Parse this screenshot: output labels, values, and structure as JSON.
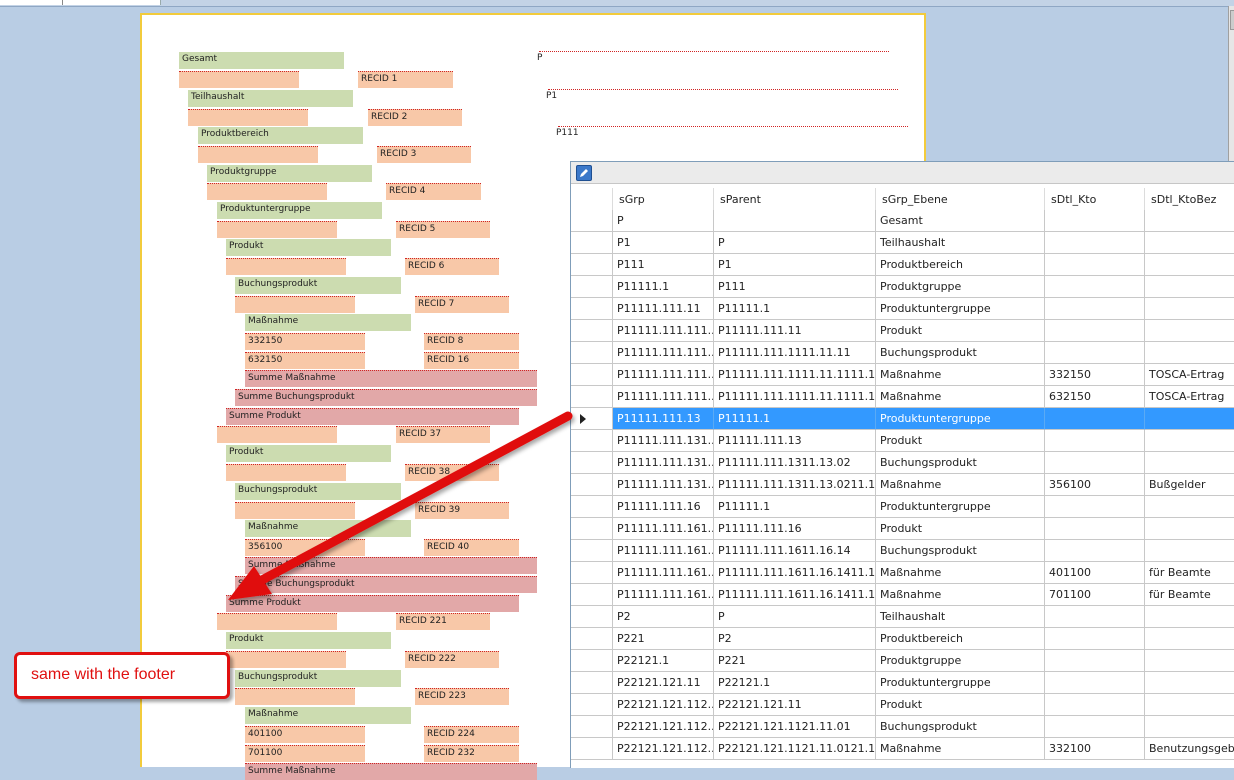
{
  "report": {
    "left_boxes": [
      {
        "kind": "g",
        "text": "Gesamt"
      },
      {
        "kind": "o",
        "text": ""
      },
      {
        "kind": "o",
        "text": "RECID  1"
      },
      {
        "kind": "g",
        "text": "Teilhaushalt"
      },
      {
        "kind": "o",
        "text": ""
      },
      {
        "kind": "o",
        "text": "RECID  2"
      },
      {
        "kind": "g",
        "text": "Produktbereich"
      },
      {
        "kind": "o",
        "text": ""
      },
      {
        "kind": "o",
        "text": "RECID  3"
      },
      {
        "kind": "g",
        "text": "Produktgruppe"
      },
      {
        "kind": "o",
        "text": ""
      },
      {
        "kind": "o",
        "text": "RECID  4"
      },
      {
        "kind": "g",
        "text": "Produktuntergruppe"
      },
      {
        "kind": "o",
        "text": ""
      },
      {
        "kind": "o",
        "text": "RECID  5"
      },
      {
        "kind": "g",
        "text": "Produkt"
      },
      {
        "kind": "o",
        "text": ""
      },
      {
        "kind": "o",
        "text": "RECID  6"
      },
      {
        "kind": "g",
        "text": "Buchungsprodukt"
      },
      {
        "kind": "o",
        "text": ""
      },
      {
        "kind": "o",
        "text": "RECID  7"
      },
      {
        "kind": "g",
        "text": "Maßnahme"
      },
      {
        "kind": "o",
        "text": "332150"
      },
      {
        "kind": "o",
        "text": "RECID  8"
      },
      {
        "kind": "o",
        "text": "632150"
      },
      {
        "kind": "o",
        "text": "RECID  16"
      },
      {
        "kind": "pk",
        "text": "Summe  Maßnahme"
      },
      {
        "kind": "pk",
        "text": "Summe  Buchungsprodukt"
      },
      {
        "kind": "pk",
        "text": "Summe  Produkt"
      },
      {
        "kind": "o",
        "text": ""
      },
      {
        "kind": "o",
        "text": "RECID  37"
      },
      {
        "kind": "g",
        "text": "Produkt"
      },
      {
        "kind": "o",
        "text": ""
      },
      {
        "kind": "o",
        "text": "RECID  38"
      },
      {
        "kind": "g",
        "text": "Buchungsprodukt"
      },
      {
        "kind": "o",
        "text": ""
      },
      {
        "kind": "o",
        "text": "RECID  39"
      },
      {
        "kind": "g",
        "text": "Maßnahme"
      },
      {
        "kind": "o",
        "text": "356100"
      },
      {
        "kind": "o",
        "text": "RECID  40"
      },
      {
        "kind": "pk",
        "text": "Summe  Maßnahme"
      },
      {
        "kind": "pk",
        "text": "Summe  Buchungsprodukt"
      },
      {
        "kind": "pk",
        "text": "Summe  Produkt"
      },
      {
        "kind": "o",
        "text": ""
      },
      {
        "kind": "o",
        "text": "RECID  221"
      },
      {
        "kind": "g",
        "text": "Produkt"
      },
      {
        "kind": "o",
        "text": ""
      },
      {
        "kind": "o",
        "text": "RECID  222"
      },
      {
        "kind": "g",
        "text": "Buchungsprodukt"
      },
      {
        "kind": "o",
        "text": ""
      },
      {
        "kind": "o",
        "text": "RECID  223"
      },
      {
        "kind": "g",
        "text": "Maßnahme"
      },
      {
        "kind": "o",
        "text": "401100"
      },
      {
        "kind": "o",
        "text": "RECID  224"
      },
      {
        "kind": "o",
        "text": "701100"
      },
      {
        "kind": "o",
        "text": "RECID  232"
      },
      {
        "kind": "pk",
        "text": "Summe  Maßnahme"
      }
    ],
    "right_labels": [
      "P",
      "P1",
      "P111"
    ]
  },
  "grid": {
    "columns": [
      "sGrp",
      "sParent",
      "sGrp_Ebene",
      "sDtl_Kto",
      "sDtl_KtoBez"
    ],
    "selected_index": 9,
    "rows": [
      [
        "P",
        "",
        "Gesamt",
        "",
        ""
      ],
      [
        "P1",
        "P",
        "Teilhaushalt",
        "",
        ""
      ],
      [
        "P111",
        "P1",
        "Produktbereich",
        "",
        ""
      ],
      [
        "P11111.1",
        "P111",
        "Produktgruppe",
        "",
        ""
      ],
      [
        "P11111.111.11",
        "P11111.1",
        "Produktuntergruppe",
        "",
        ""
      ],
      [
        "P11111.111.111...",
        "P11111.111.11",
        "Produkt",
        "",
        ""
      ],
      [
        "P11111.111.111...",
        "P11111.111.1111.11.11",
        "Buchungsprodukt",
        "",
        ""
      ],
      [
        "P11111.111.111...",
        "P11111.111.1111.11.1111.11....",
        "Maßnahme",
        "332150",
        "TOSCA-Ertrag"
      ],
      [
        "P11111.111.111...",
        "P11111.111.1111.11.1111.11....",
        "Maßnahme",
        "632150",
        "TOSCA-Ertrag"
      ],
      [
        "P11111.111.13",
        "P11111.1",
        "Produktuntergruppe",
        "",
        ""
      ],
      [
        "P11111.111.131...",
        "P11111.111.13",
        "Produkt",
        "",
        ""
      ],
      [
        "P11111.111.131...",
        "P11111.111.1311.13.02",
        "Buchungsprodukt",
        "",
        ""
      ],
      [
        "P11111.111.131...",
        "P11111.111.1311.13.0211.13....",
        "Maßnahme",
        "356100",
        "Bußgelder"
      ],
      [
        "P11111.111.16",
        "P11111.1",
        "Produktuntergruppe",
        "",
        ""
      ],
      [
        "P11111.111.161...",
        "P11111.111.16",
        "Produkt",
        "",
        ""
      ],
      [
        "P11111.111.161...",
        "P11111.111.1611.16.14",
        "Buchungsprodukt",
        "",
        ""
      ],
      [
        "P11111.111.161...",
        "P11111.111.1611.16.1411.16....",
        "Maßnahme",
        "401100",
        "für Beamte"
      ],
      [
        "P11111.111.161...",
        "P11111.111.1611.16.1411.16....",
        "Maßnahme",
        "701100",
        "für Beamte"
      ],
      [
        "P2",
        "P",
        "Teilhaushalt",
        "",
        ""
      ],
      [
        "P221",
        "P2",
        "Produktbereich",
        "",
        ""
      ],
      [
        "P22121.1",
        "P221",
        "Produktgruppe",
        "",
        ""
      ],
      [
        "P22121.121.11",
        "P22121.1",
        "Produktuntergruppe",
        "",
        ""
      ],
      [
        "P22121.121.112...",
        "P22121.121.11",
        "Produkt",
        "",
        ""
      ],
      [
        "P22121.121.112...",
        "P22121.121.1121.11.01",
        "Buchungsprodukt",
        "",
        ""
      ],
      [
        "P22121.121.112...",
        "P22121.121.1121.11.0121.11....",
        "Maßnahme",
        "332100",
        "Benutzungsgebü..."
      ]
    ]
  },
  "callout": {
    "text": "same with the footer"
  },
  "colors": {
    "accent_red": "#e01010",
    "selection": "#3399ff"
  }
}
